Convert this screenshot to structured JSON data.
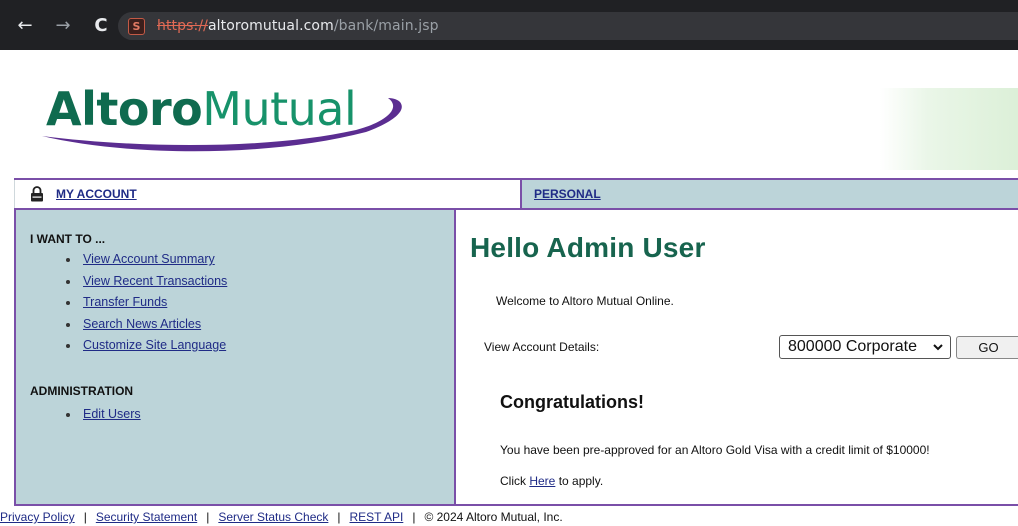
{
  "browser": {
    "url_scheme": "https://",
    "url_host": "altoromutual.com",
    "url_path": "/bank/main.jsp",
    "nav_icons": [
      "arrow-left-icon",
      "arrow-right-icon",
      "reload-icon"
    ],
    "site_badge": "S"
  },
  "logo": {
    "part_bold": "Altoro",
    "part_light": "Mutual",
    "colors": {
      "bold": "#0f6b4f",
      "light": "#17926a",
      "swoosh": "#5b2d91"
    }
  },
  "topnav": {
    "my_account": "MY ACCOUNT",
    "personal": "PERSONAL"
  },
  "sidebar": {
    "i_want_to_heading": "I WANT TO ...",
    "i_want_to_items": [
      "View Account Summary",
      "View Recent Transactions",
      "Transfer Funds",
      "Search News Articles",
      "Customize Site Language"
    ],
    "administration_heading": "ADMINISTRATION",
    "administration_items": [
      "Edit Users"
    ]
  },
  "main": {
    "greeting": "Hello Admin User",
    "welcome": "Welcome to Altoro Mutual Online.",
    "view_details_label": "View Account Details:",
    "account_selected": "800000 Corporate",
    "go_label": "GO",
    "congrats_heading": "Congratulations!",
    "preapproved_text": "You have been pre-approved for an Altoro Gold Visa with a credit limit of $10000!",
    "click_prefix": "Click ",
    "click_link": "Here",
    "click_suffix": " to apply."
  },
  "footer": {
    "links": [
      "Privacy Policy",
      "Security Statement",
      "Server Status Check",
      "REST API"
    ],
    "separator": "|",
    "copyright": "© 2024 Altoro Mutual, Inc."
  },
  "colors": {
    "accent_purple": "#7a4fa8",
    "sidebar_bg": "#bcd4d9",
    "heading_green": "#17644e",
    "link_blue": "#1f2b86"
  }
}
